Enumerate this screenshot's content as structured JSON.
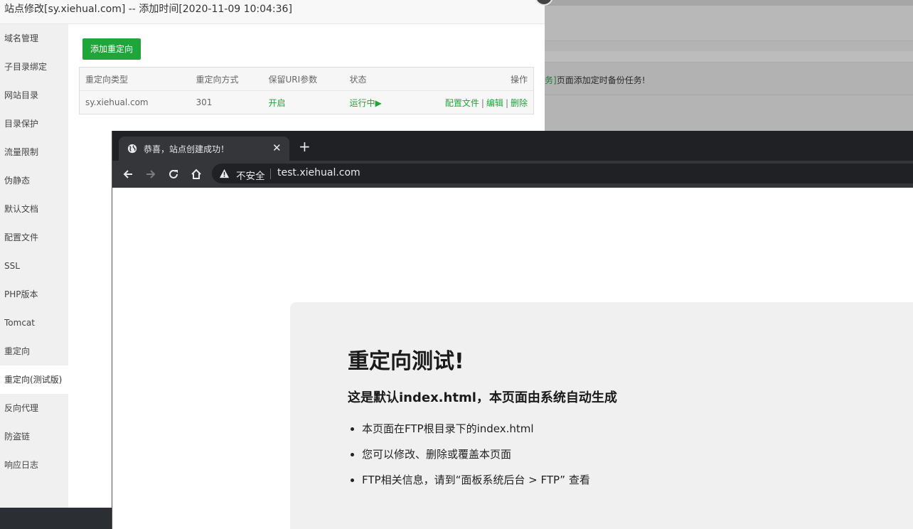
{
  "background": {
    "notice_text_prefix": "务]",
    "notice_text": "页面添加定时备份任务!"
  },
  "dialog": {
    "title": "站点修改[sy.xiehual.com] -- 添加时间[2020-11-09 10:04:36]",
    "sidebar": {
      "items": [
        {
          "label": "域名管理"
        },
        {
          "label": "子目录绑定"
        },
        {
          "label": "网站目录"
        },
        {
          "label": "目录保护"
        },
        {
          "label": "流量限制"
        },
        {
          "label": "伪静态"
        },
        {
          "label": "默认文档"
        },
        {
          "label": "配置文件"
        },
        {
          "label": "SSL"
        },
        {
          "label": "PHP版本"
        },
        {
          "label": "Tomcat"
        },
        {
          "label": "重定向"
        },
        {
          "label": "重定向(测试版)",
          "active": true
        },
        {
          "label": "反向代理"
        },
        {
          "label": "防盗链"
        },
        {
          "label": "响应日志"
        }
      ]
    },
    "add_button": "添加重定向",
    "table": {
      "headers": [
        "重定向类型",
        "重定向方式",
        "保留URI参数",
        "状态",
        "操作"
      ],
      "rows": [
        {
          "type": "sy.xiehual.com",
          "method": "301",
          "keep_uri": "开启",
          "status": "运行中▶",
          "actions": {
            "config": "配置文件",
            "edit": "编辑",
            "delete": "删除",
            "sep": "|"
          }
        }
      ]
    }
  },
  "browser": {
    "tab_title": "恭喜，站点创建成功！",
    "tab_close": "✕",
    "new_tab": "+",
    "security_label": "不安全",
    "url": "test.xiehual.com",
    "page": {
      "heading": "重定向测试!",
      "subheading": "这是默认index.html，本页面由系统自动生成",
      "bullets": [
        "本页面在FTP根目录下的index.html",
        "您可以修改、删除或覆盖本页面",
        "FTP相关信息，请到“面板系统后台 > FTP” 查看"
      ]
    }
  },
  "colors": {
    "accent_green": "#20a53a",
    "chrome_dark": "#202124",
    "chrome_toolbar": "#35363a"
  }
}
